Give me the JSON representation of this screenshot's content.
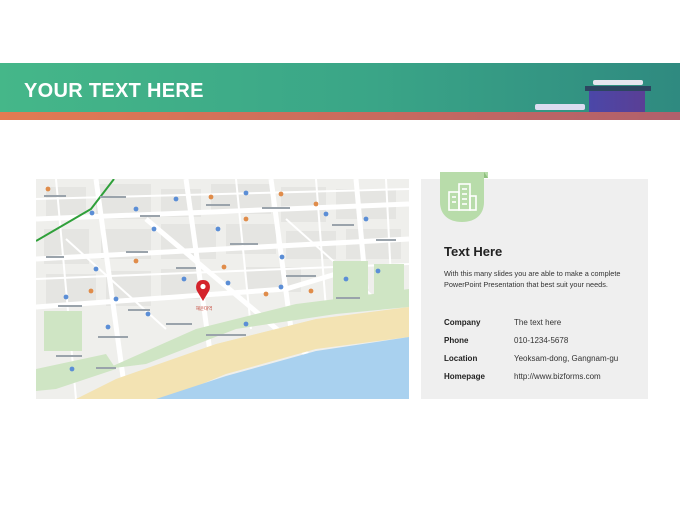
{
  "header": {
    "title": "YOUR TEXT HERE"
  },
  "colors": {
    "brand_green": "#45b789",
    "accent_orange": "#e27b52",
    "pin_red": "#d4232b",
    "card_bg": "#efefef",
    "icon_green": "#b8dcaa"
  },
  "map": {
    "pin_label": "해운대역"
  },
  "card": {
    "icon": "buildings-icon",
    "title": "Text Here",
    "description": "With this many slides you are able to make a complete PowerPoint Presentation that best suit your needs.",
    "rows": [
      {
        "label": "Company",
        "value": "The text here"
      },
      {
        "label": "Phone",
        "value": "010-1234-5678"
      },
      {
        "label": "Location",
        "value": "Yeoksam-dong, Gangnam-gu"
      },
      {
        "label": "Homepage",
        "value": "http://www.bizforms.com"
      }
    ]
  }
}
